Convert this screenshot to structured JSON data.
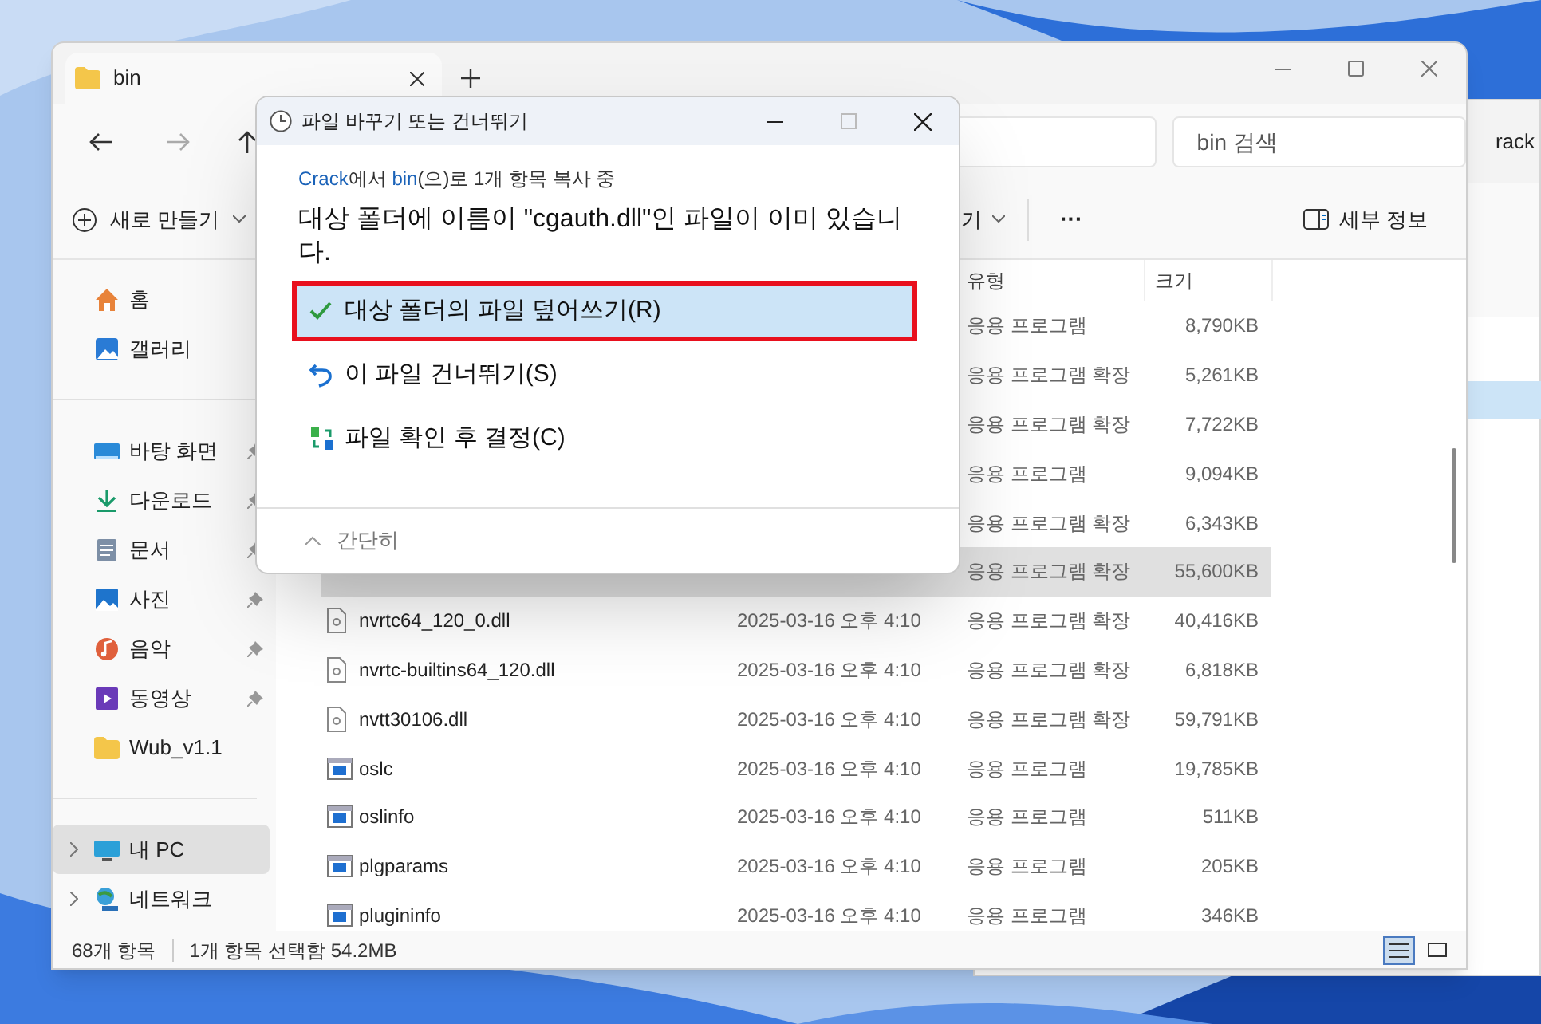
{
  "back_window": {
    "address_text": "rack"
  },
  "explorer": {
    "tab": {
      "title": "bin"
    },
    "search": {
      "placeholder": "bin 검색"
    },
    "commands": [
      {
        "kind": "new",
        "label": "새로 만들기"
      },
      {
        "kind": "view",
        "label": "기"
      },
      {
        "kind": "more",
        "label": "···"
      },
      {
        "kind": "details",
        "label": "세부 정보"
      }
    ],
    "sidebar": [
      {
        "kind": "home",
        "label": "홈",
        "pinned": false,
        "selected": false
      },
      {
        "kind": "gallery",
        "label": "갤러리",
        "pinned": false,
        "selected": false
      },
      {
        "kind": "divider"
      },
      {
        "kind": "desktop",
        "label": "바탕 화면",
        "pinned": true,
        "selected": false
      },
      {
        "kind": "download",
        "label": "다운로드",
        "pinned": true,
        "selected": false
      },
      {
        "kind": "document",
        "label": "문서",
        "pinned": true,
        "selected": false
      },
      {
        "kind": "picture",
        "label": "사진",
        "pinned": true,
        "selected": false
      },
      {
        "kind": "music",
        "label": "음악",
        "pinned": true,
        "selected": false
      },
      {
        "kind": "video",
        "label": "동영상",
        "pinned": true,
        "selected": false
      },
      {
        "kind": "folder",
        "label": "Wub_v1.1",
        "pinned": false,
        "selected": false
      },
      {
        "kind": "divider"
      },
      {
        "kind": "pc",
        "label": "내 PC",
        "pinned": false,
        "selected": true,
        "expandable": true
      },
      {
        "kind": "network",
        "label": "네트워크",
        "pinned": false,
        "selected": false,
        "expandable": true
      }
    ],
    "table": {
      "columns": [
        "유형",
        "크기"
      ],
      "rows": [
        {
          "type": "응용 프로그램",
          "size": "8,790KB",
          "selected": false
        },
        {
          "type": "응용 프로그램 확장",
          "size": "5,261KB",
          "selected": false
        },
        {
          "type": "응용 프로그램 확장",
          "size": "7,722KB",
          "selected": false
        },
        {
          "type": "응용 프로그램",
          "size": "9,094KB",
          "selected": false
        },
        {
          "type": "응용 프로그램 확장",
          "size": "6,343KB",
          "selected": false
        },
        {
          "type": "응용 프로그램 확장",
          "size": "55,600KB",
          "selected": true
        },
        {
          "kind": "dll",
          "name": "nvrtc64_120_0.dll",
          "date": "2025-03-16 오후 4:10",
          "type": "응용 프로그램 확장",
          "size": "40,416KB",
          "selected": false
        },
        {
          "kind": "dll",
          "name": "nvrtc-builtins64_120.dll",
          "date": "2025-03-16 오후 4:10",
          "type": "응용 프로그램 확장",
          "size": "6,818KB",
          "selected": false
        },
        {
          "kind": "dll",
          "name": "nvtt30106.dll",
          "date": "2025-03-16 오후 4:10",
          "type": "응용 프로그램 확장",
          "size": "59,791KB",
          "selected": false
        },
        {
          "kind": "exe",
          "name": "oslc",
          "date": "2025-03-16 오후 4:10",
          "type": "응용 프로그램",
          "size": "19,785KB",
          "selected": false
        },
        {
          "kind": "exe",
          "name": "oslinfo",
          "date": "2025-03-16 오후 4:10",
          "type": "응용 프로그램",
          "size": "511KB",
          "selected": false
        },
        {
          "kind": "exe",
          "name": "plgparams",
          "date": "2025-03-16 오후 4:10",
          "type": "응용 프로그램",
          "size": "205KB",
          "selected": false
        },
        {
          "kind": "exe",
          "name": "plugininfo",
          "date": "2025-03-16 오후 4:10",
          "type": "응용 프로그램",
          "size": "346KB",
          "selected": false
        }
      ]
    },
    "status_bar": {
      "count": "68개 항목",
      "selection": "1개 항목 선택함 54.2MB"
    }
  },
  "dialog": {
    "title": "파일 바꾸기 또는 건너뛰기",
    "progress": [
      {
        "kind": "link",
        "text": "Crack"
      },
      {
        "kind": "plain",
        "text": "에서 "
      },
      {
        "kind": "link",
        "text": "bin"
      },
      {
        "kind": "plain",
        "text": "(으)로 1개 항목 복사 중"
      }
    ],
    "message": "대상 폴더에 이름이 \"cgauth.dll\"인 파일이 이미 있습니다.",
    "options": [
      {
        "kind": "replace",
        "label": "대상 폴더의 파일 덮어쓰기(R)",
        "selected": true
      },
      {
        "kind": "skip",
        "label": "이 파일 건너뛰기(S)",
        "selected": false
      },
      {
        "kind": "compare",
        "label": "파일 확인 후 결정(C)",
        "selected": false
      }
    ],
    "footer": "간단히"
  }
}
